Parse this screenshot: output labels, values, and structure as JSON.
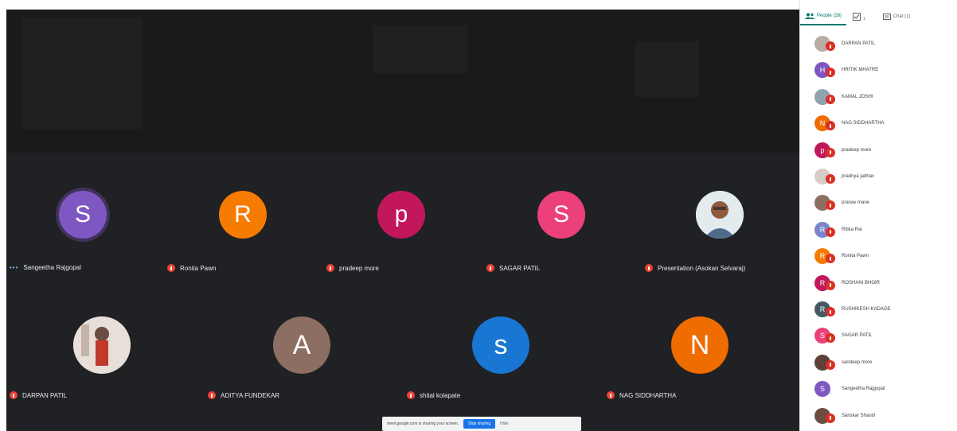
{
  "meeting": {
    "tiles": [
      {
        "name": "Sangeetha Rajgopal",
        "initial": "S",
        "color": "#7e57c2",
        "speaking": true
      },
      {
        "name": "Ronita Pawn",
        "initial": "R",
        "color": "#f57c00",
        "speaking": false
      },
      {
        "name": "pradeep more",
        "initial": "p",
        "color": "#c2185b",
        "speaking": false
      },
      {
        "name": "SAGAR PATIL",
        "initial": "S",
        "color": "#ec407a",
        "speaking": false
      },
      {
        "name": "Presentation (Asokan Selvaraj)",
        "initial": "",
        "color": "#cfd8dc",
        "speaking": false,
        "photo": true
      },
      {
        "name": "DARPAN PATIL",
        "initial": "",
        "color": "#d7ccc8",
        "speaking": false,
        "photo": true
      },
      {
        "name": "ADITYA FUNDEKAR",
        "initial": "A",
        "color": "#8d6e63",
        "speaking": false
      },
      {
        "name": "shital kolapate",
        "initial": "s",
        "color": "#1976d2",
        "speaking": false
      },
      {
        "name": "NAG SIDDHARTHA",
        "initial": "N",
        "color": "#ef6c00",
        "speaking": false
      }
    ]
  },
  "share_bar": {
    "text": "meet.google.com is sharing your screen.",
    "stop_label": "Stop sharing",
    "hide_label": "Hide"
  },
  "panel": {
    "tab_people": "People (28)",
    "tab_tasks_count": "1",
    "tab_chat": "Chat (1)",
    "people": [
      {
        "name": "DARPAN PATIL",
        "initial": "",
        "color": "#bcaaa4"
      },
      {
        "name": "HRITIK MHATRE",
        "initial": "H",
        "color": "#7e57c2"
      },
      {
        "name": "KAMAL JOSHI",
        "initial": "",
        "color": "#90a4ae"
      },
      {
        "name": "NAG SIDDHARTHA",
        "initial": "N",
        "color": "#ef6c00"
      },
      {
        "name": "pradeep more",
        "initial": "p",
        "color": "#c2185b"
      },
      {
        "name": "pradnya jadhav",
        "initial": "",
        "color": "#d7ccc8"
      },
      {
        "name": "pranav mane",
        "initial": "",
        "color": "#8d6e63"
      },
      {
        "name": "Ritika Rai",
        "initial": "R",
        "color": "#7986cb"
      },
      {
        "name": "Ronita Pawn",
        "initial": "R",
        "color": "#f57c00"
      },
      {
        "name": "ROSHANI BHOIR",
        "initial": "R",
        "color": "#c2185b"
      },
      {
        "name": "RUSHIKESH KADAGE",
        "initial": "R",
        "color": "#455a64"
      },
      {
        "name": "SAGAR PATIL",
        "initial": "S",
        "color": "#ec407a"
      },
      {
        "name": "sandeep more",
        "initial": "",
        "color": "#5d4037"
      },
      {
        "name": "Sangeetha Rajgopal",
        "initial": "S",
        "color": "#7e57c2"
      },
      {
        "name": "Sanskar Shastri",
        "initial": "",
        "color": "#6d4c41"
      }
    ]
  }
}
